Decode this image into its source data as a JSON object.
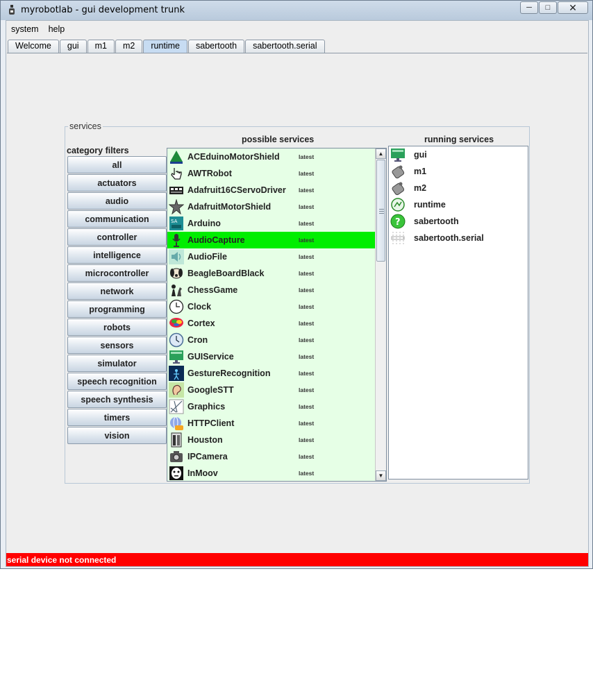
{
  "window": {
    "title": "myrobotlab - gui development trunk"
  },
  "menu": [
    "system",
    "help"
  ],
  "tabs": [
    {
      "label": "Welcome",
      "active": false
    },
    {
      "label": "gui",
      "active": false
    },
    {
      "label": "m1",
      "active": false
    },
    {
      "label": "m2",
      "active": false
    },
    {
      "label": "runtime",
      "active": true
    },
    {
      "label": "sabertooth",
      "active": false
    },
    {
      "label": "sabertooth.serial",
      "active": false
    }
  ],
  "services_panel": {
    "title": "services",
    "category_label": "category filters",
    "possible_label": "possible services",
    "running_label": "running services"
  },
  "categories": [
    "all",
    "actuators",
    "audio",
    "communication",
    "controller",
    "intelligence",
    "microcontroller",
    "network",
    "programming",
    "robots",
    "sensors",
    "simulator",
    "speech recognition",
    "speech synthesis",
    "timers",
    "vision"
  ],
  "possible_services": [
    {
      "name": "ACEduinoMotorShield",
      "version": "latest",
      "icon": "aceduino-icon"
    },
    {
      "name": "AWTRobot",
      "version": "latest",
      "icon": "hand-pointer-icon"
    },
    {
      "name": "Adafruit16CServoDriver",
      "version": "latest",
      "icon": "servo-board-icon"
    },
    {
      "name": "AdafruitMotorShield",
      "version": "latest",
      "icon": "adafruit-star-icon"
    },
    {
      "name": "Arduino",
      "version": "latest",
      "icon": "arduino-icon"
    },
    {
      "name": "AudioCapture",
      "version": "latest",
      "icon": "microphone-icon",
      "selected": true
    },
    {
      "name": "AudioFile",
      "version": "latest",
      "icon": "speaker-icon"
    },
    {
      "name": "BeagleBoardBlack",
      "version": "latest",
      "icon": "beagle-dog-icon"
    },
    {
      "name": "ChessGame",
      "version": "latest",
      "icon": "chess-icon"
    },
    {
      "name": "Clock",
      "version": "latest",
      "icon": "clock-icon"
    },
    {
      "name": "Cortex",
      "version": "latest",
      "icon": "brain-icon"
    },
    {
      "name": "Cron",
      "version": "latest",
      "icon": "cron-clock-icon"
    },
    {
      "name": "GUIService",
      "version": "latest",
      "icon": "gui-monitor-icon"
    },
    {
      "name": "GestureRecognition",
      "version": "latest",
      "icon": "gesture-icon"
    },
    {
      "name": "GoogleSTT",
      "version": "latest",
      "icon": "ear-icon"
    },
    {
      "name": "Graphics",
      "version": "latest",
      "icon": "graphics-icon"
    },
    {
      "name": "HTTPClient",
      "version": "latest",
      "icon": "globe-icon"
    },
    {
      "name": "Houston",
      "version": "latest",
      "icon": "robot-icon"
    },
    {
      "name": "IPCamera",
      "version": "latest",
      "icon": "camera-icon"
    },
    {
      "name": "InMoov",
      "version": "latest",
      "icon": "inmoov-face-icon"
    }
  ],
  "running_services": [
    {
      "name": "gui",
      "icon": "gui-monitor-icon"
    },
    {
      "name": "m1",
      "icon": "motor-icon"
    },
    {
      "name": "m2",
      "icon": "motor-icon"
    },
    {
      "name": "runtime",
      "icon": "runtime-icon"
    },
    {
      "name": "sabertooth",
      "icon": "question-icon"
    },
    {
      "name": "sabertooth.serial",
      "icon": "serial-icon"
    }
  ],
  "status": {
    "text": "serial device not connected",
    "color": "#ff0000"
  },
  "colors": {
    "selected_row": "#00ee00",
    "list_background": "#e6ffe6",
    "active_tab": "#c7dcf2"
  }
}
